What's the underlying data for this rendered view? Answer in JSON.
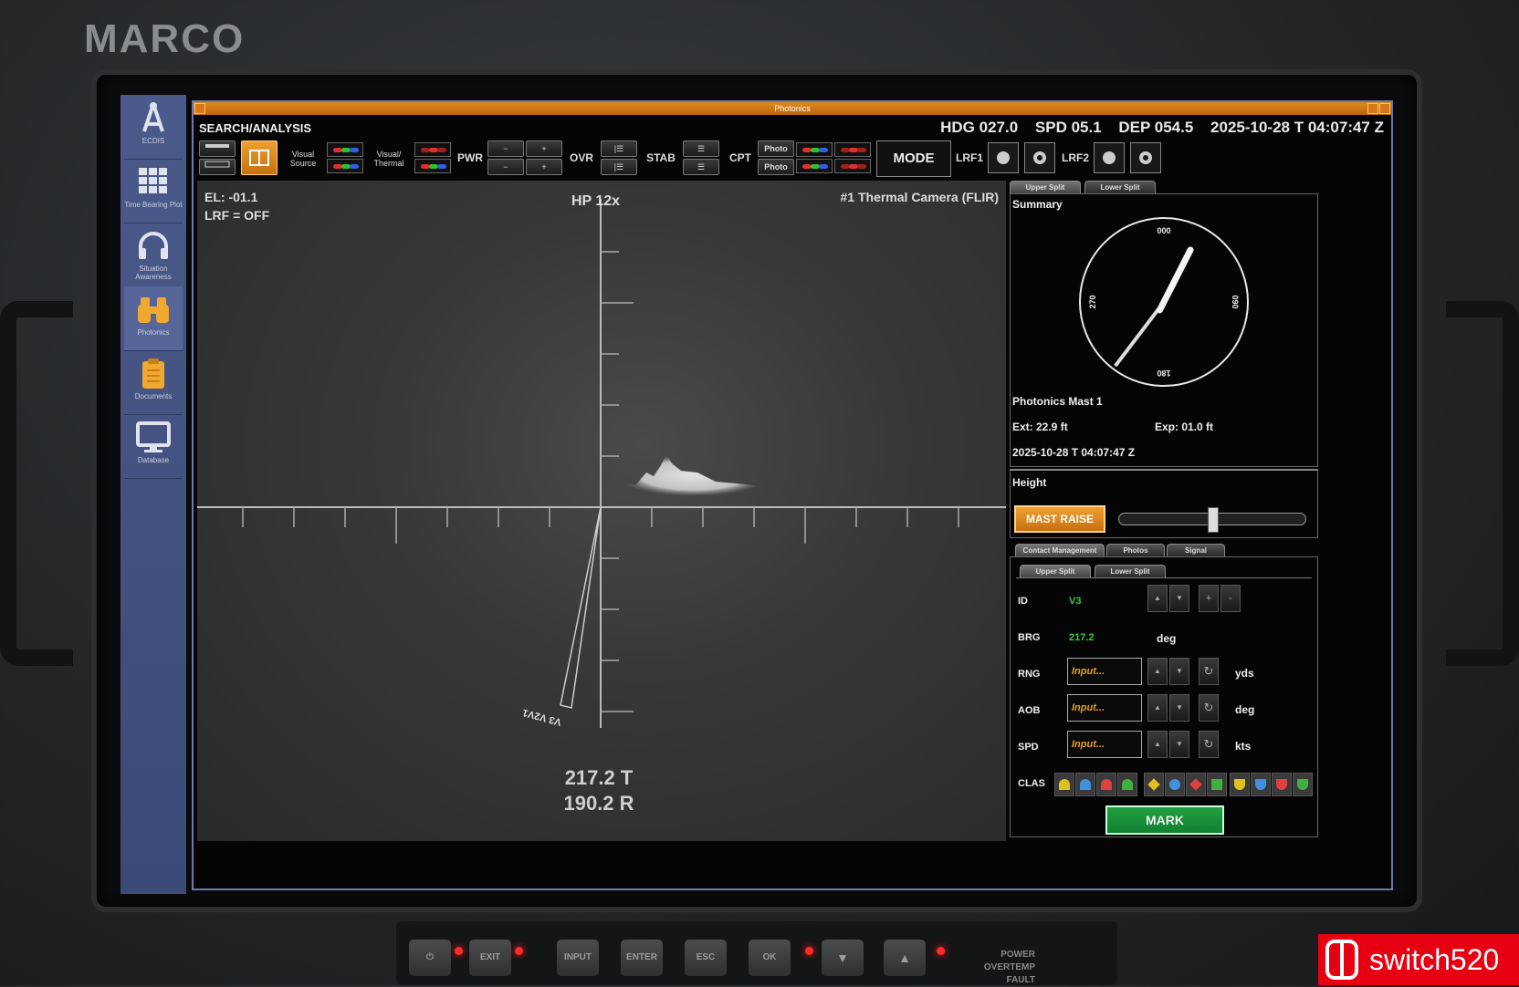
{
  "brand": "MARCO",
  "sidebar": {
    "items": [
      {
        "label": "ECDIS"
      },
      {
        "label": "Time Bearing Plot"
      },
      {
        "label": "Situation Awareness"
      },
      {
        "label": "Photonics"
      },
      {
        "label": "Documents"
      },
      {
        "label": "Database"
      }
    ]
  },
  "window": {
    "title": "Photonics",
    "mode_label": "SEARCH/ANALYSIS",
    "hdg": "HDG 027.0",
    "spd": "SPD 05.1",
    "dep": "DEP 054.5",
    "datetime": "2025-10-28 T 04:07:47 Z"
  },
  "toolbar": {
    "visual_source": "Visual Source",
    "visual_thermal": "Visual/ Thermal",
    "pwr": "PWR",
    "ovr": "OVR",
    "stab": "STAB",
    "cpt": "CPT",
    "photo": "Photo",
    "mode": "MODE",
    "lrf1": "LRF1",
    "lrf2": "LRF2"
  },
  "camera": {
    "el": "EL: -01.1",
    "lrf": "LRF = OFF",
    "zoom": "HP 12x",
    "source": "#1 Thermal Camera (FLIR)",
    "contact_label": "V3 V2V1",
    "bearing_true": "217.2 T",
    "bearing_rel": "190.2 R"
  },
  "summary": {
    "tabs": [
      "Upper Split",
      "Lower Split"
    ],
    "title": "Summary",
    "compass": {
      "n": "000",
      "e": "090",
      "s": "180",
      "w": "270",
      "heading_deg": 27,
      "bearing_deg": 217.2
    },
    "mast_name": "Photonics Mast 1",
    "ext": "Ext: 22.9 ft",
    "exp": "Exp: 01.0 ft",
    "datetime": "2025-10-28 T 04:07:47 Z"
  },
  "height": {
    "title": "Height",
    "mast_raise": "MAST RAISE",
    "level": 0.5
  },
  "contact": {
    "tabs": [
      "Contact Management",
      "Photos",
      "Signal"
    ],
    "subtabs": [
      "Upper Split",
      "Lower Split"
    ],
    "id_label": "ID",
    "id_value": "V3",
    "brg_label": "BRG",
    "brg_value": "217.2",
    "brg_unit": "deg",
    "rng_label": "RNG",
    "rng_unit": "yds",
    "aob_label": "AOB",
    "aob_unit": "deg",
    "spd_label": "SPD",
    "spd_unit": "kts",
    "input_placeholder": "Input...",
    "clas_label": "CLAS",
    "mark": "MARK",
    "plus": "+",
    "minus": "-"
  },
  "hardware": {
    "buttons": [
      "⏻",
      "EXIT",
      "INPUT",
      "ENTER",
      "ESC",
      "OK",
      "▼",
      "▲"
    ],
    "status": [
      "POWER",
      "OVERTEMP",
      "FAULT"
    ]
  },
  "watermark": "switch520",
  "colors": {
    "accent": "#e08a1a",
    "green": "#3ccd3c",
    "sidebar": "#4b5a8a"
  }
}
